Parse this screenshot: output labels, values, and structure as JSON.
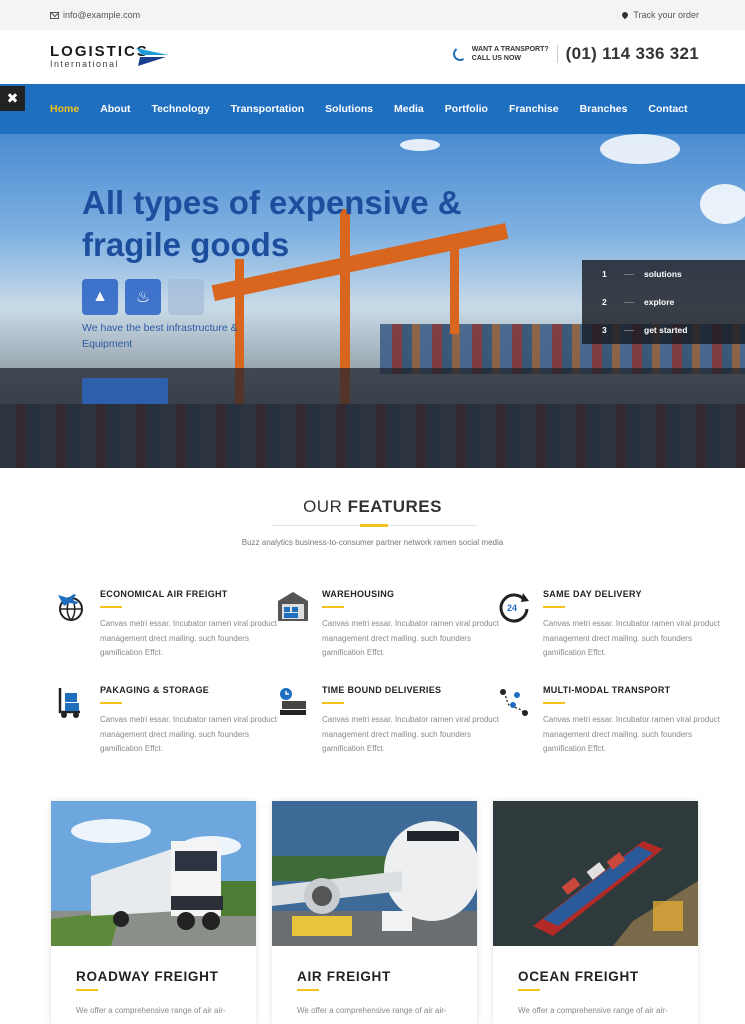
{
  "topbar": {
    "email": "info@example.com",
    "track": "Track your order"
  },
  "header": {
    "logo_main": "LOGISTICS",
    "logo_sub": "International",
    "want_line1": "WANT A TRANSPORT?",
    "want_line2": "CALL US NOW",
    "phone": "(01) 114 336 321"
  },
  "nav": {
    "items": [
      "Home",
      "About",
      "Technology",
      "Transportation",
      "Solutions",
      "Media",
      "Portfolio",
      "Franchise",
      "Branches",
      "Contact"
    ],
    "active": "Home"
  },
  "hero": {
    "title": "All types of expensive & fragile goods",
    "description": "We have the best infrastructure & Equipment",
    "slider": [
      {
        "num": "1",
        "label": "solutions"
      },
      {
        "num": "2",
        "label": "explore"
      },
      {
        "num": "3",
        "label": "get started"
      }
    ]
  },
  "features": {
    "title_light": "OUR",
    "title_bold": "FEATURES",
    "subtitle": "Buzz analytics business-to-consumer partner network ramen social media",
    "items": [
      {
        "title": "ECONOMICAL AIR FREIGHT",
        "text": "Canvas metri essar. Incubator ramen viral product management drect mailing. such founders gamification Effct.",
        "icon": "globe-plane-icon"
      },
      {
        "title": "WAREHOUSING",
        "text": "Canvas metri essar. Incubator ramen viral product management drect mailing. such founders gamification Effct.",
        "icon": "warehouse-icon"
      },
      {
        "title": "SAME DAY DELIVERY",
        "text": "Canvas metri essar. Incubator ramen viral product management drect mailing. such founders gamification Effct.",
        "icon": "clock-24h-icon"
      },
      {
        "title": "PAKAGING & STORAGE",
        "text": "Canvas metri essar. Incubator ramen viral product management drect mailing. such founders gamification Effct.",
        "icon": "hand-truck-icon"
      },
      {
        "title": "TIME BOUND DELIVERIES",
        "text": "Canvas metri essar. Incubator ramen viral product management drect mailing. such founders gamification Effct.",
        "icon": "timed-delivery-icon"
      },
      {
        "title": "MULTI-MODAL TRANSPORT",
        "text": "Canvas metri essar. Incubator ramen viral product management drect mailing. such founders gamification Effct.",
        "icon": "route-pins-icon"
      }
    ]
  },
  "services": [
    {
      "title": "ROADWAY FREIGHT",
      "text": "We offer a comprehensive range of air air-"
    },
    {
      "title": "AIR FREIGHT",
      "text": "We offer a comprehensive range of air air-"
    },
    {
      "title": "OCEAN FREIGHT",
      "text": "We offer a comprehensive range of air air-"
    }
  ],
  "colors": {
    "brand_blue": "#1f6fc1",
    "accent_yellow": "#f3c21b",
    "hero_title": "#1d4e9e"
  }
}
